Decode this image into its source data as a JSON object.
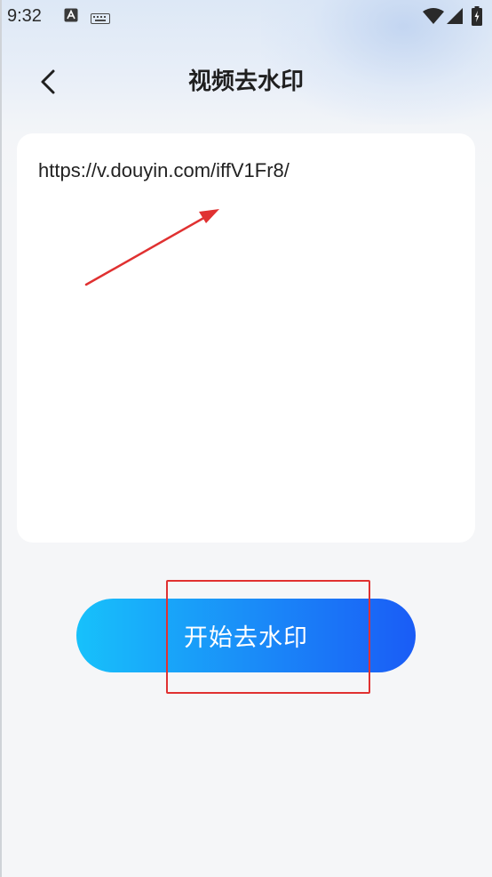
{
  "status_bar": {
    "time": "9:32",
    "icons": [
      "a-notification-icon",
      "keyboard-icon",
      "wifi-icon",
      "signal-icon",
      "battery-icon"
    ]
  },
  "header": {
    "title": "视频去水印",
    "back_icon": "chevron-left-icon"
  },
  "input": {
    "value": "https://v.douyin.com/iffV1Fr8/"
  },
  "actions": {
    "start_label": "开始去水印"
  },
  "colors": {
    "button_gradient_start": "#17c1fb",
    "button_gradient_end": "#1a5cf6",
    "annotation_red": "#e03131"
  }
}
